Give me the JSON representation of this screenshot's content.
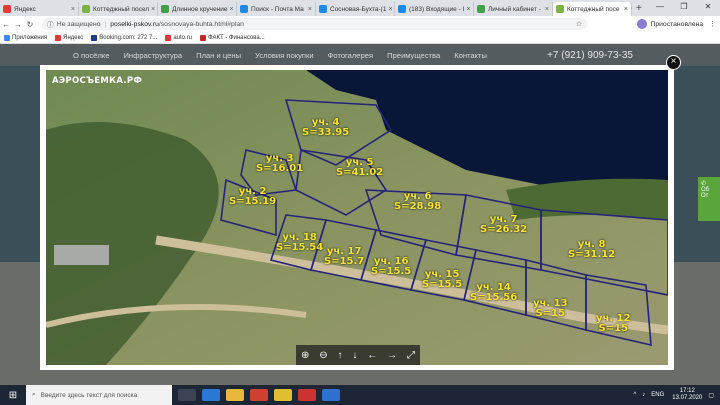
{
  "browser": {
    "tabs": [
      {
        "label": "Яндекс",
        "color": "#e53935",
        "active": false
      },
      {
        "label": "Коттеджный посел",
        "color": "#7cb342",
        "active": false
      },
      {
        "label": "Длинное кручение",
        "color": "#43a047",
        "active": false
      },
      {
        "label": "Поиск - Почта Ма",
        "color": "#1e88e5",
        "active": false
      },
      {
        "label": "Сосновая-Бухта-(1",
        "color": "#1e88e5",
        "active": false
      },
      {
        "label": "(183) Входящие - I",
        "color": "#1e88e5",
        "active": false
      },
      {
        "label": "Личный кабинет -",
        "color": "#43a047",
        "active": false
      },
      {
        "label": "Коттеджный посе",
        "color": "#7cb342",
        "active": true
      }
    ],
    "new_tab": "+",
    "window_controls": [
      "—",
      "❐",
      "✕"
    ],
    "address": {
      "security": "Не защищено",
      "domain": "poselki-pskov.ru",
      "path": "/sosnovaya-buhta.html#plan"
    },
    "profile": "Приостановлена",
    "bookmarks": [
      {
        "label": "Приложения",
        "color": "#4285f4"
      },
      {
        "label": "Яндекс",
        "color": "#e53935"
      },
      {
        "label": "Booking.com: 272 7...",
        "color": "#1e3a8a"
      },
      {
        "label": "auto.ru",
        "color": "#e53935"
      },
      {
        "label": "ФАКТ - Финансова...",
        "color": "#c62828"
      }
    ]
  },
  "site": {
    "menu": [
      "О посёлке",
      "Инфраструктура",
      "План и цены",
      "Условия покупки",
      "Фотогалерея",
      "Преимущества",
      "Контакты"
    ],
    "phone": "+7 (921) 909-73-35",
    "side_widget": [
      "Об",
      "От"
    ]
  },
  "lightbox": {
    "watermark": "АЭРОСЪЕМКА.РФ",
    "close": "×",
    "controls": [
      "⊕",
      "⊖",
      "↑",
      "↓",
      "←",
      "→",
      "⤢"
    ],
    "plots": [
      {
        "name": "уч. 4",
        "area": "S=33.95"
      },
      {
        "name": "уч. 3",
        "area": "S=16.01"
      },
      {
        "name": "уч. 5",
        "area": "S=41.02"
      },
      {
        "name": "уч. 2",
        "area": "S=15.19"
      },
      {
        "name": "уч. 6",
        "area": "S=28.98"
      },
      {
        "name": "уч. 7",
        "area": "S=26.32"
      },
      {
        "name": "уч. 8",
        "area": "S=31.12"
      },
      {
        "name": "уч. 18",
        "area": "S=15.54"
      },
      {
        "name": "уч. 17",
        "area": "S=15.7"
      },
      {
        "name": "уч. 16",
        "area": "S=15.5"
      },
      {
        "name": "уч. 15",
        "area": "S=15.5"
      },
      {
        "name": "уч. 14",
        "area": "S=15.56"
      },
      {
        "name": "уч. 13",
        "area": "S=15"
      },
      {
        "name": "уч. 12",
        "area": "S=15"
      }
    ]
  },
  "taskbar": {
    "search_placeholder": "Введите здесь текст для поиска",
    "lang": "ENG",
    "time": "17:12",
    "date": "13.07.2020"
  }
}
